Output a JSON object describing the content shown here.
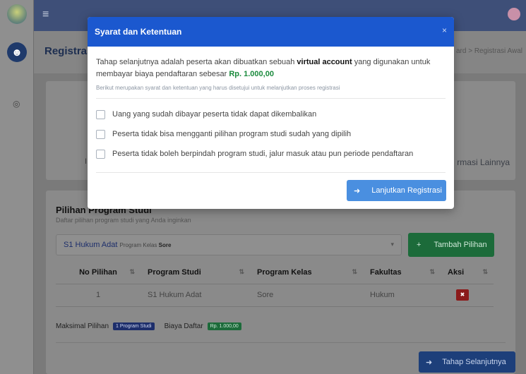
{
  "topbar": {
    "menu_icon": "hamburger-icon",
    "user_icon": "user-icon"
  },
  "header": {
    "title": "Registrasi",
    "breadcrumb": "ard  >  Registrasi Awal"
  },
  "card1": {
    "peek_left": "I",
    "peek_right": "rmasi Lainnya"
  },
  "pilihan": {
    "title": "Pilihan Program Studi",
    "subtitle": "Daftar pilihan program studi yang Anda inginkan",
    "select_value": "S1 Hukum Adat",
    "select_meta_prefix": "Program Kelas",
    "select_meta_value": "Sore",
    "add_button": "Tambah Pilihan",
    "columns": [
      "No Pilihan",
      "Program Studi",
      "Program Kelas",
      "Fakultas",
      "Aksi"
    ],
    "rows": [
      {
        "no": "1",
        "prodi": "S1 Hukum Adat",
        "kelas": "Sore",
        "fakultas": "Hukum"
      }
    ],
    "max_label": "Maksimal Pilihan",
    "max_badge": "1 Program Studi",
    "biaya_label": "Biaya Daftar",
    "biaya_badge": "Rp. 1.000,00",
    "next_button": "Tahap Selanjutnya"
  },
  "modal": {
    "title": "Syarat dan Ketentuan",
    "close": "×",
    "lead_1": "Tahap selanjutnya adalah peserta akan dibuatkan sebuah ",
    "lead_bold": "virtual account",
    "lead_2": " yang digunakan untuk membayar biaya pendaftaran sebesar ",
    "lead_amount": "Rp. 1.000,00",
    "note": "Berikut merupakan syarat dan ketentuan yang harus disetujui untuk melanjutkan proses registrasi",
    "terms": [
      "Uang yang sudah dibayar peserta tidak dapat dikembalikan",
      "Peserta tidak bisa mengganti pilihan program studi sudah yang dipilih",
      "Peserta tidak boleh berpindah program studi, jalur masuk atau pun periode pendaftaran"
    ],
    "continue_button": "Lanjutkan Registrasi"
  },
  "colors": {
    "modal_header": "#1b58cf",
    "primary_button": "#4a8fe0",
    "amount": "#1a8a3c"
  }
}
